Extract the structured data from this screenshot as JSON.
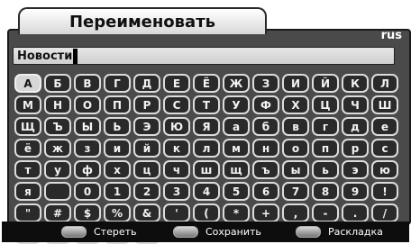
{
  "title": "Переименовать",
  "language": "rus",
  "input": {
    "value": "Новости"
  },
  "keys": [
    "А",
    "Б",
    "В",
    "Г",
    "Д",
    "Е",
    "Ё",
    "Ж",
    "З",
    "И",
    "Й",
    "К",
    "Л",
    "М",
    "Н",
    "О",
    "П",
    "Р",
    "С",
    "Т",
    "У",
    "Ф",
    "Х",
    "Ц",
    "Ч",
    "Ш",
    "Щ",
    "Ъ",
    "Ы",
    "Ь",
    "Э",
    "Ю",
    "Я",
    "а",
    "б",
    "в",
    "г",
    "д",
    "е",
    "ё",
    "ж",
    "з",
    "и",
    "й",
    "к",
    "л",
    "м",
    "н",
    "о",
    "п",
    "р",
    "с",
    "т",
    "у",
    "ф",
    "х",
    "ц",
    "ч",
    "ш",
    "щ",
    "ъ",
    "ы",
    "ь",
    "э",
    "ю",
    "я",
    "",
    "0",
    "1",
    "2",
    "3",
    "4",
    "5",
    "6",
    "7",
    "8",
    "9",
    "!",
    "\"",
    "#",
    "$",
    "%",
    "&",
    "'",
    "(",
    "*",
    "+",
    ",",
    "-",
    ".",
    "/",
    ":",
    ";",
    "<",
    "=",
    ">"
  ],
  "selected_key": "А",
  "footer": {
    "erase": "Стереть",
    "save": "Сохранить",
    "layout": "Раскладка"
  }
}
